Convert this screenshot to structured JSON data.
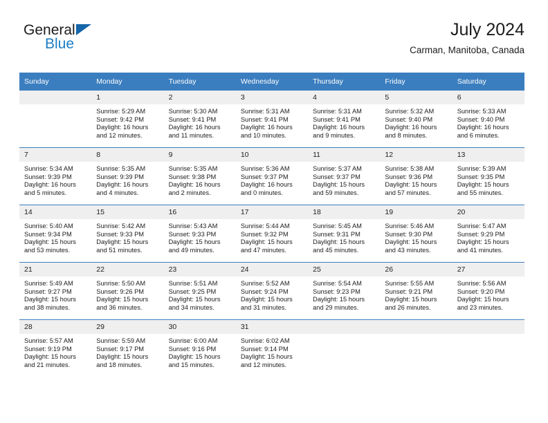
{
  "brand": {
    "name_part1": "General",
    "name_part2": "Blue",
    "triangle_icon": "triangle-icon",
    "accent_blue": "#1b7dc4",
    "logo_triangle_blue": "#1565a8"
  },
  "header": {
    "title": "July 2024",
    "subtitle": "Carman, Manitoba, Canada"
  },
  "theme": {
    "header_row_bg": "#3b7ebf",
    "daynum_band_bg": "#efefef",
    "row_divider": "#3b7ebf",
    "text": "#202020"
  },
  "calendar": {
    "weekday_headers": [
      "Sunday",
      "Monday",
      "Tuesday",
      "Wednesday",
      "Thursday",
      "Friday",
      "Saturday"
    ],
    "weeks": [
      [
        {
          "day": "",
          "info": ""
        },
        {
          "day": "1",
          "info": "Sunrise: 5:29 AM\nSunset: 9:42 PM\nDaylight: 16 hours\nand 12 minutes."
        },
        {
          "day": "2",
          "info": "Sunrise: 5:30 AM\nSunset: 9:41 PM\nDaylight: 16 hours\nand 11 minutes."
        },
        {
          "day": "3",
          "info": "Sunrise: 5:31 AM\nSunset: 9:41 PM\nDaylight: 16 hours\nand 10 minutes."
        },
        {
          "day": "4",
          "info": "Sunrise: 5:31 AM\nSunset: 9:41 PM\nDaylight: 16 hours\nand 9 minutes."
        },
        {
          "day": "5",
          "info": "Sunrise: 5:32 AM\nSunset: 9:40 PM\nDaylight: 16 hours\nand 8 minutes."
        },
        {
          "day": "6",
          "info": "Sunrise: 5:33 AM\nSunset: 9:40 PM\nDaylight: 16 hours\nand 6 minutes."
        }
      ],
      [
        {
          "day": "7",
          "info": "Sunrise: 5:34 AM\nSunset: 9:39 PM\nDaylight: 16 hours\nand 5 minutes."
        },
        {
          "day": "8",
          "info": "Sunrise: 5:35 AM\nSunset: 9:39 PM\nDaylight: 16 hours\nand 4 minutes."
        },
        {
          "day": "9",
          "info": "Sunrise: 5:35 AM\nSunset: 9:38 PM\nDaylight: 16 hours\nand 2 minutes."
        },
        {
          "day": "10",
          "info": "Sunrise: 5:36 AM\nSunset: 9:37 PM\nDaylight: 16 hours\nand 0 minutes."
        },
        {
          "day": "11",
          "info": "Sunrise: 5:37 AM\nSunset: 9:37 PM\nDaylight: 15 hours\nand 59 minutes."
        },
        {
          "day": "12",
          "info": "Sunrise: 5:38 AM\nSunset: 9:36 PM\nDaylight: 15 hours\nand 57 minutes."
        },
        {
          "day": "13",
          "info": "Sunrise: 5:39 AM\nSunset: 9:35 PM\nDaylight: 15 hours\nand 55 minutes."
        }
      ],
      [
        {
          "day": "14",
          "info": "Sunrise: 5:40 AM\nSunset: 9:34 PM\nDaylight: 15 hours\nand 53 minutes."
        },
        {
          "day": "15",
          "info": "Sunrise: 5:42 AM\nSunset: 9:33 PM\nDaylight: 15 hours\nand 51 minutes."
        },
        {
          "day": "16",
          "info": "Sunrise: 5:43 AM\nSunset: 9:33 PM\nDaylight: 15 hours\nand 49 minutes."
        },
        {
          "day": "17",
          "info": "Sunrise: 5:44 AM\nSunset: 9:32 PM\nDaylight: 15 hours\nand 47 minutes."
        },
        {
          "day": "18",
          "info": "Sunrise: 5:45 AM\nSunset: 9:31 PM\nDaylight: 15 hours\nand 45 minutes."
        },
        {
          "day": "19",
          "info": "Sunrise: 5:46 AM\nSunset: 9:30 PM\nDaylight: 15 hours\nand 43 minutes."
        },
        {
          "day": "20",
          "info": "Sunrise: 5:47 AM\nSunset: 9:29 PM\nDaylight: 15 hours\nand 41 minutes."
        }
      ],
      [
        {
          "day": "21",
          "info": "Sunrise: 5:49 AM\nSunset: 9:27 PM\nDaylight: 15 hours\nand 38 minutes."
        },
        {
          "day": "22",
          "info": "Sunrise: 5:50 AM\nSunset: 9:26 PM\nDaylight: 15 hours\nand 36 minutes."
        },
        {
          "day": "23",
          "info": "Sunrise: 5:51 AM\nSunset: 9:25 PM\nDaylight: 15 hours\nand 34 minutes."
        },
        {
          "day": "24",
          "info": "Sunrise: 5:52 AM\nSunset: 9:24 PM\nDaylight: 15 hours\nand 31 minutes."
        },
        {
          "day": "25",
          "info": "Sunrise: 5:54 AM\nSunset: 9:23 PM\nDaylight: 15 hours\nand 29 minutes."
        },
        {
          "day": "26",
          "info": "Sunrise: 5:55 AM\nSunset: 9:21 PM\nDaylight: 15 hours\nand 26 minutes."
        },
        {
          "day": "27",
          "info": "Sunrise: 5:56 AM\nSunset: 9:20 PM\nDaylight: 15 hours\nand 23 minutes."
        }
      ],
      [
        {
          "day": "28",
          "info": "Sunrise: 5:57 AM\nSunset: 9:19 PM\nDaylight: 15 hours\nand 21 minutes."
        },
        {
          "day": "29",
          "info": "Sunrise: 5:59 AM\nSunset: 9:17 PM\nDaylight: 15 hours\nand 18 minutes."
        },
        {
          "day": "30",
          "info": "Sunrise: 6:00 AM\nSunset: 9:16 PM\nDaylight: 15 hours\nand 15 minutes."
        },
        {
          "day": "31",
          "info": "Sunrise: 6:02 AM\nSunset: 9:14 PM\nDaylight: 15 hours\nand 12 minutes."
        },
        {
          "day": "",
          "info": ""
        },
        {
          "day": "",
          "info": ""
        },
        {
          "day": "",
          "info": ""
        }
      ]
    ]
  }
}
